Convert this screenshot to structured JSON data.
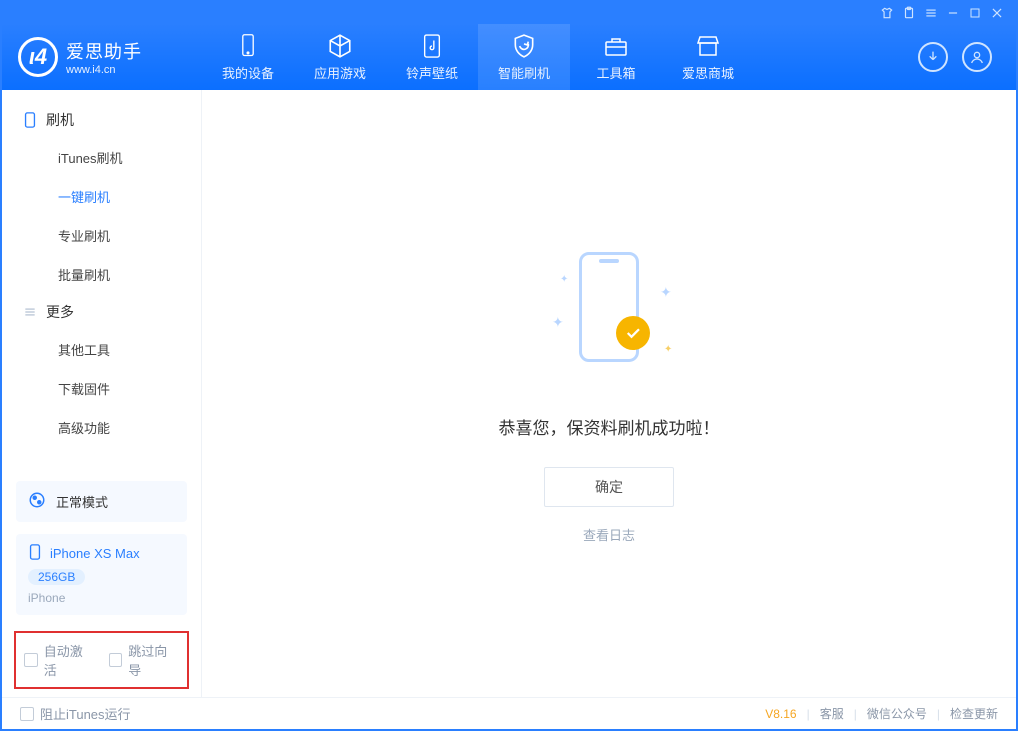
{
  "titlebar": {
    "icons": [
      "tshirt-icon",
      "clipboard-icon",
      "menu-icon",
      "minimize-icon",
      "maximize-icon",
      "close-icon"
    ]
  },
  "logo": {
    "cn": "爱思助手",
    "en": "www.i4.cn"
  },
  "nav": [
    {
      "label": "我的设备",
      "icon": "device-icon"
    },
    {
      "label": "应用游戏",
      "icon": "cube-icon"
    },
    {
      "label": "铃声壁纸",
      "icon": "music-file-icon"
    },
    {
      "label": "智能刷机",
      "icon": "refresh-shield-icon",
      "active": true
    },
    {
      "label": "工具箱",
      "icon": "toolbox-icon"
    },
    {
      "label": "爱思商城",
      "icon": "store-icon"
    }
  ],
  "header_right": [
    "download-icon",
    "user-icon"
  ],
  "sidebar": {
    "groups": [
      {
        "title": "刷机",
        "icon": "phone-icon",
        "items": [
          "iTunes刷机",
          "一键刷机",
          "专业刷机",
          "批量刷机"
        ],
        "active_index": 1
      },
      {
        "title": "更多",
        "icon": "list-icon",
        "items": [
          "其他工具",
          "下载固件",
          "高级功能"
        ],
        "active_index": -1
      }
    ],
    "mode": {
      "label": "正常模式",
      "icon": "mode-icon"
    },
    "device": {
      "name": "iPhone XS Max",
      "capacity": "256GB",
      "type": "iPhone"
    },
    "options": {
      "auto_activate": "自动激活",
      "skip_guide": "跳过向导"
    }
  },
  "main": {
    "success_msg": "恭喜您，保资料刷机成功啦！",
    "ok_button": "确定",
    "view_log": "查看日志"
  },
  "footer": {
    "block_itunes": "阻止iTunes运行",
    "version": "V8.16",
    "links": [
      "客服",
      "微信公众号",
      "检查更新"
    ]
  },
  "colors": {
    "primary": "#2a7fff",
    "accent": "#f7b500",
    "danger_border": "#e03030"
  }
}
